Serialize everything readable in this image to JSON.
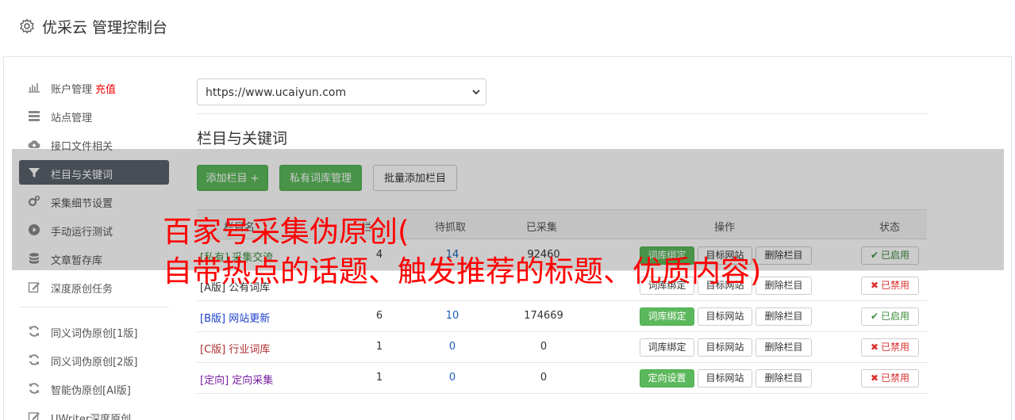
{
  "header": {
    "title": "优采云 管理控制台",
    "icon": "gear-icon"
  },
  "sidebar": {
    "items": [
      {
        "label": "账户管理",
        "extra": "充值",
        "icon": "bar-chart-icon",
        "active": false
      },
      {
        "label": "站点管理",
        "icon": "server-icon",
        "active": false
      },
      {
        "label": "接口文件相关",
        "icon": "cloud-upload-icon",
        "active": false
      },
      {
        "label": "栏目与关键词",
        "icon": "filter-icon",
        "active": true
      },
      {
        "label": "采集细节设置",
        "icon": "cogs-icon",
        "active": false
      },
      {
        "label": "手动运行测试",
        "icon": "play-circle-icon",
        "active": false
      },
      {
        "label": "文章暂存库",
        "icon": "database-icon",
        "active": false
      },
      {
        "label": "深度原创任务",
        "icon": "edit-icon",
        "active": false
      }
    ],
    "items2": [
      {
        "label": "同义词伪原创[1版]",
        "icon": "refresh-icon"
      },
      {
        "label": "同义词伪原创[2版]",
        "icon": "refresh-icon"
      },
      {
        "label": "智能伪原创[AI版]",
        "icon": "refresh-icon"
      },
      {
        "label": "UWriter深度原创",
        "icon": "edit-icon"
      }
    ]
  },
  "main": {
    "site_select": "https://www.ucaiyun.com",
    "section_title": "栏目与关键词",
    "buttons": {
      "add_column": "添加栏目 +",
      "private_lib": "私有词库管理",
      "batch_add": "批量添加栏目"
    },
    "table": {
      "headers": [
        "栏目名",
        "待抓取",
        "已采集",
        "操作",
        "状态"
      ],
      "header_partial": "栏",
      "rows": [
        {
          "tag": "[私有]",
          "name": "采集交流",
          "col1": "4",
          "pending": "14",
          "collected": "92460",
          "bind_label": "词库绑定",
          "bind_style": "green",
          "status": "已启用",
          "enabled": true,
          "color": "#3c8d3c"
        },
        {
          "tag": "[A版]",
          "name": "公有词库",
          "col1": "",
          "pending": "",
          "collected": "",
          "bind_label": "词库绑定",
          "bind_style": "def",
          "status": "已禁用",
          "enabled": false,
          "color": "#333333"
        },
        {
          "tag": "[B版]",
          "name": "网站更新",
          "col1": "6",
          "pending": "10",
          "collected": "174669",
          "bind_label": "词库绑定",
          "bind_style": "green",
          "status": "已启用",
          "enabled": true,
          "color": "#1a3fcc"
        },
        {
          "tag": "[C版]",
          "name": "行业词库",
          "col1": "1",
          "pending": "0",
          "collected": "0",
          "bind_label": "词库绑定",
          "bind_style": "def",
          "status": "已禁用",
          "enabled": false,
          "color": "#b03030"
        },
        {
          "tag": "[定向]",
          "name": "定向采集",
          "col1": "1",
          "pending": "0",
          "collected": "0",
          "bind_label": "定向设置",
          "bind_style": "green",
          "status": "已禁用",
          "enabled": false,
          "color": "#7a1fa2"
        }
      ],
      "target_site_label": "目标网站",
      "delete_label": "删除栏目"
    }
  },
  "overlay": {
    "line1": "百家号采集伪原创(",
    "line2": "自带热点的话题、触发推荐的标题、优质内容)"
  },
  "colors": {
    "green": "#5cb85c",
    "active_nav": "#5a626b",
    "red": "#ff0000"
  }
}
